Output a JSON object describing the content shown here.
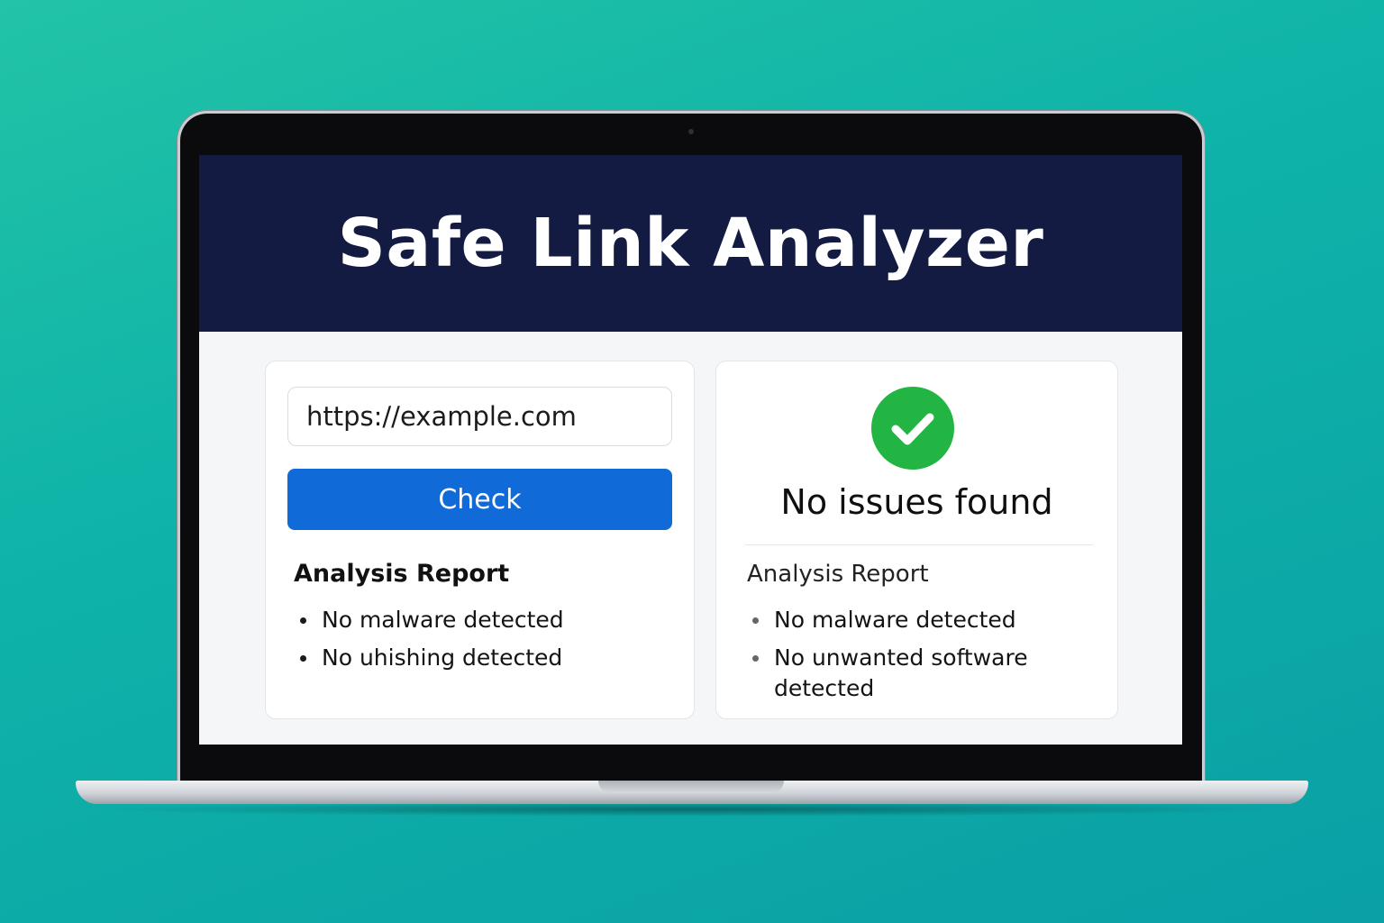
{
  "app": {
    "title": "Safe Link Analyzer"
  },
  "scan_form": {
    "url_value": "https://example.com",
    "check_label": "Check"
  },
  "left_report": {
    "heading": "Analysis Report",
    "items": [
      "No malware detected",
      "No uhishing detected"
    ]
  },
  "result_panel": {
    "status_icon": "check-icon",
    "status_text": "No issues found",
    "heading": "Analysis Report",
    "items": [
      "No malware detected",
      "No unwanted software detected"
    ]
  },
  "colors": {
    "header_bg": "#141b42",
    "button_bg": "#106bd8",
    "success_green": "#22b543",
    "background_teal": "#0fb3a8"
  }
}
